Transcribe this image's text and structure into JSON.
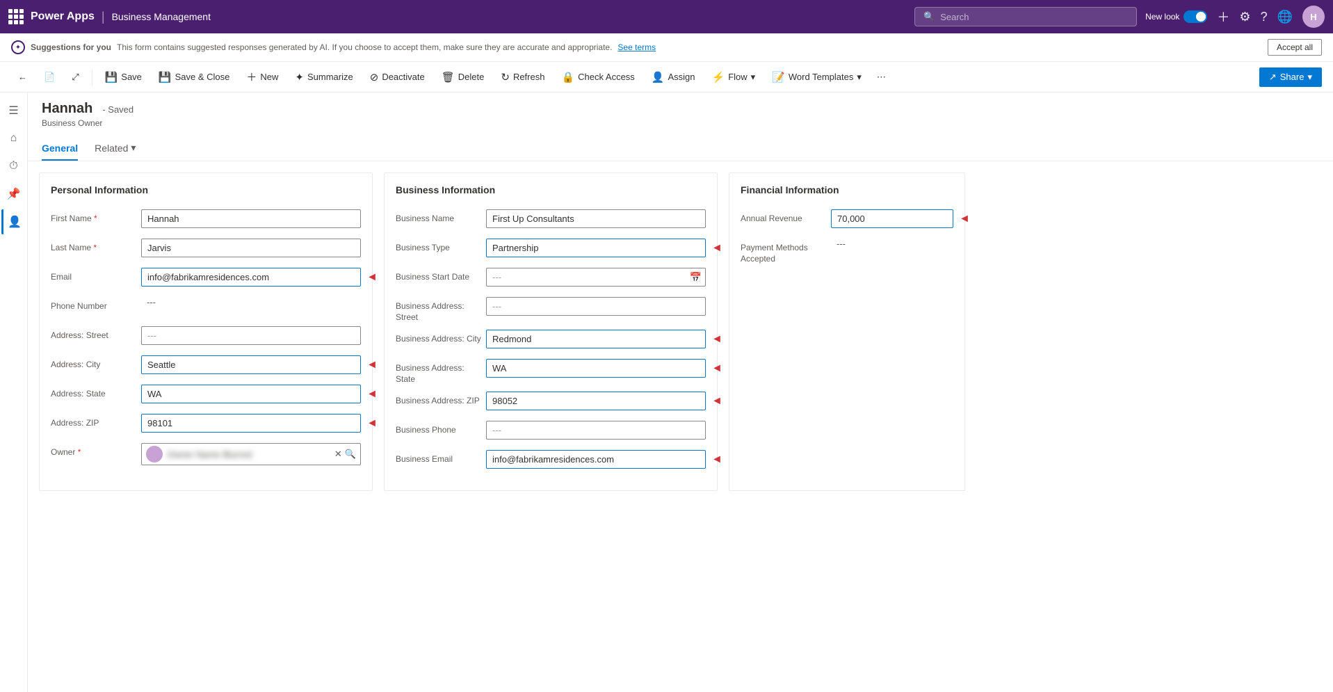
{
  "topNav": {
    "appName": "Power Apps",
    "divider": "|",
    "moduleName": "Business Management",
    "searchPlaceholder": "Search",
    "newLookLabel": "New look",
    "avatarInitials": "H"
  },
  "suggestionBar": {
    "text": "Suggestions for you",
    "description": " This form contains suggested responses generated by AI. If you choose to accept them, make sure they are accurate and appropriate.",
    "linkText": "See terms",
    "acceptAllLabel": "Accept all"
  },
  "toolbar": {
    "backLabel": "←",
    "saveLabel": "Save",
    "saveCloseLabel": "Save & Close",
    "newLabel": "New",
    "summarizeLabel": "Summarize",
    "deactivateLabel": "Deactivate",
    "deleteLabel": "Delete",
    "refreshLabel": "Refresh",
    "checkAccessLabel": "Check Access",
    "assignLabel": "Assign",
    "flowLabel": "Flow",
    "wordTemplatesLabel": "Word Templates",
    "shareLabel": "Share",
    "moreLabel": "⋯"
  },
  "sidebar": {
    "items": [
      {
        "icon": "☰",
        "name": "menu"
      },
      {
        "icon": "⌂",
        "name": "home"
      },
      {
        "icon": "⏱",
        "name": "recent"
      },
      {
        "icon": "📌",
        "name": "pinned"
      },
      {
        "icon": "👤",
        "name": "contacts",
        "active": true
      }
    ]
  },
  "record": {
    "firstName": "Hannah",
    "savedLabel": "- Saved",
    "role": "Business Owner",
    "tabs": [
      {
        "label": "General",
        "active": true
      },
      {
        "label": "Related",
        "active": false,
        "hasChevron": true
      }
    ]
  },
  "personalInfo": {
    "title": "Personal Information",
    "fields": [
      {
        "label": "First Name",
        "required": true,
        "value": "Hannah",
        "type": "input",
        "highlighted": false,
        "arrow": false
      },
      {
        "label": "Last Name",
        "required": true,
        "value": "Jarvis",
        "type": "input",
        "highlighted": false,
        "arrow": false
      },
      {
        "label": "Email",
        "required": false,
        "value": "info@fabrikamresidences.com",
        "type": "input",
        "highlighted": true,
        "arrow": true
      },
      {
        "label": "Phone Number",
        "required": false,
        "value": "---",
        "type": "static",
        "arrow": false
      },
      {
        "label": "Address: Street",
        "required": false,
        "value": "---",
        "type": "static",
        "arrow": false
      },
      {
        "label": "Address: City",
        "required": false,
        "value": "Seattle",
        "type": "input",
        "highlighted": true,
        "arrow": true
      },
      {
        "label": "Address: State",
        "required": false,
        "value": "WA",
        "type": "input",
        "highlighted": true,
        "arrow": true
      },
      {
        "label": "Address: ZIP",
        "required": false,
        "value": "98101",
        "type": "input",
        "highlighted": true,
        "arrow": true
      },
      {
        "label": "Owner",
        "required": true,
        "value": "Owner Name",
        "type": "owner",
        "arrow": false
      }
    ]
  },
  "businessInfo": {
    "title": "Business Information",
    "fields": [
      {
        "label": "Business Name",
        "value": "First Up Consultants",
        "type": "input",
        "highlighted": false,
        "arrow": false
      },
      {
        "label": "Business Type",
        "value": "Partnership",
        "type": "input",
        "highlighted": true,
        "arrow": true
      },
      {
        "label": "Business Start Date",
        "value": "---",
        "type": "date",
        "arrow": false
      },
      {
        "label": "Business Address: Street",
        "value": "---",
        "type": "static",
        "arrow": false
      },
      {
        "label": "Business Address: City",
        "value": "Redmond",
        "type": "input",
        "highlighted": true,
        "arrow": true
      },
      {
        "label": "Business Address: State",
        "value": "WA",
        "type": "input",
        "highlighted": true,
        "arrow": true
      },
      {
        "label": "Business Address: ZIP",
        "value": "98052",
        "type": "input",
        "highlighted": true,
        "arrow": true
      },
      {
        "label": "Business Phone",
        "value": "---",
        "type": "static",
        "arrow": false
      },
      {
        "label": "Business Email",
        "value": "info@fabrikamresidences.com",
        "type": "input",
        "highlighted": true,
        "arrow": true
      }
    ]
  },
  "financialInfo": {
    "title": "Financial Information",
    "fields": [
      {
        "label": "Annual Revenue",
        "value": "70,000",
        "type": "input",
        "highlighted": true,
        "arrow": true
      },
      {
        "label": "Payment Methods Accepted",
        "value": "---",
        "type": "static",
        "arrow": false
      }
    ]
  }
}
